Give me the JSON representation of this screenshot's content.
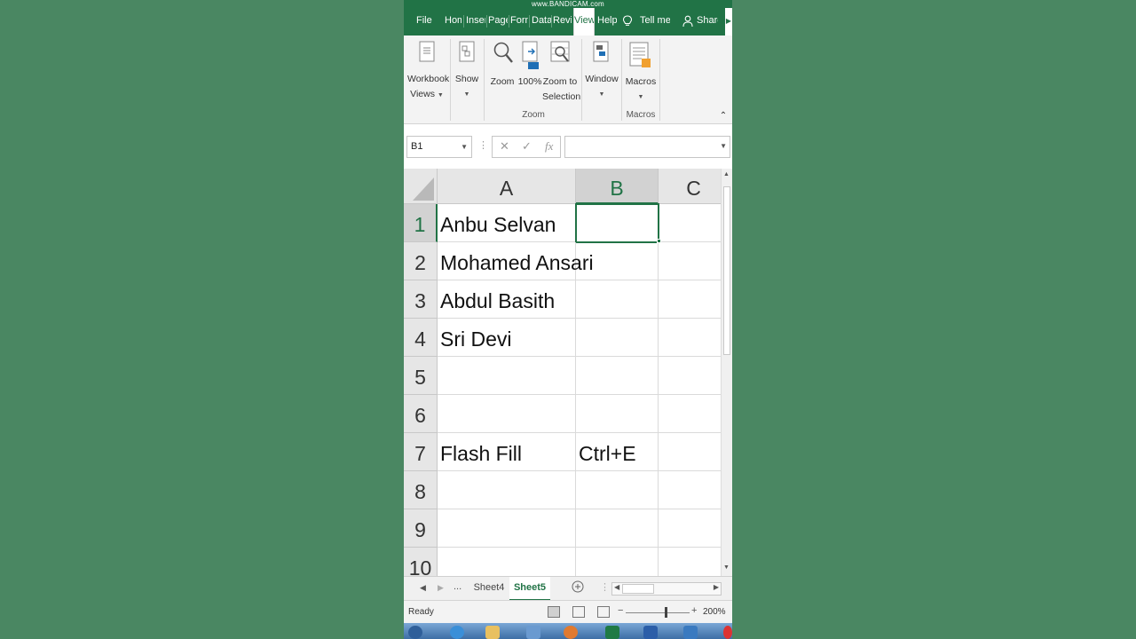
{
  "watermark": "www.BANDICAM.com",
  "tabs": [
    {
      "label": "File"
    },
    {
      "label": "Hom"
    },
    {
      "label": "Inser"
    },
    {
      "label": "Page"
    },
    {
      "label": "Forn"
    },
    {
      "label": "Data"
    },
    {
      "label": "Revi"
    },
    {
      "label": "View"
    },
    {
      "label": "Help"
    }
  ],
  "tell_me": "Tell me",
  "share": "Share",
  "ribbon": {
    "workbook_views": [
      "Workbook",
      "Views"
    ],
    "show": "Show",
    "zoom": "Zoom",
    "zoom_100": "100%",
    "zoom_to_selection": [
      "Zoom to",
      "Selection"
    ],
    "window": "Window",
    "macros": "Macros",
    "group_zoom": "Zoom",
    "group_macros": "Macros"
  },
  "formula_bar": {
    "name_box": "B1",
    "cancel": "✕",
    "enter": "✓",
    "fx": "fx",
    "value": ""
  },
  "grid": {
    "columns": [
      "A",
      "B",
      "C"
    ],
    "rows": [
      {
        "n": "1",
        "a": "Anbu Selvan",
        "b": ""
      },
      {
        "n": "2",
        "a": "Mohamed Ansari",
        "b": ""
      },
      {
        "n": "3",
        "a": "Abdul Basith",
        "b": ""
      },
      {
        "n": "4",
        "a": "Sri Devi",
        "b": ""
      },
      {
        "n": "5",
        "a": "",
        "b": ""
      },
      {
        "n": "6",
        "a": "",
        "b": ""
      },
      {
        "n": "7",
        "a": "Flash Fill",
        "b": "Ctrl+E"
      },
      {
        "n": "8",
        "a": "",
        "b": ""
      },
      {
        "n": "9",
        "a": "",
        "b": ""
      },
      {
        "n": "10",
        "a": "",
        "b": ""
      }
    ]
  },
  "sheets": {
    "ellipsis": "...",
    "tabs": [
      "Sheet4",
      "Sheet5"
    ],
    "active": "Sheet5"
  },
  "status": {
    "text": "Ready",
    "zoom_level": "200%"
  },
  "colors": {
    "excel_green": "#217346",
    "background": "#4a8762"
  }
}
